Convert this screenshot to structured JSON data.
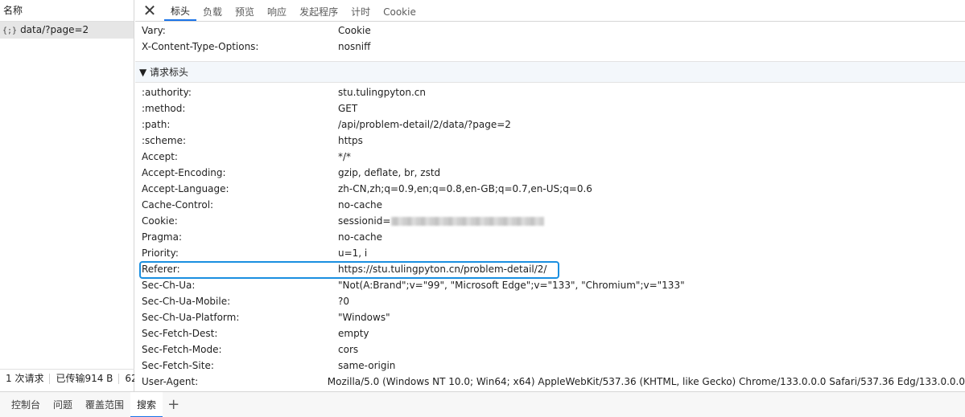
{
  "left": {
    "header": "名称",
    "request_icon": "{;}",
    "request_name": "data/?page=2",
    "status": {
      "requests": "1 次请求",
      "transferred": "已传输914 B",
      "extra": "62"
    }
  },
  "tabs": [
    "标头",
    "负载",
    "预览",
    "响应",
    "发起程序",
    "计时",
    "Cookie"
  ],
  "active_tab": 0,
  "close_icon": "close-icon",
  "response_headers": [
    {
      "key": "Vary:",
      "value": "Cookie"
    },
    {
      "key": "X-Content-Type-Options:",
      "value": "nosniff"
    }
  ],
  "request_section_title": "▼ 请求标头",
  "request_headers": [
    {
      "key": ":authority:",
      "value": "stu.tulingpyton.cn"
    },
    {
      "key": ":method:",
      "value": "GET"
    },
    {
      "key": ":path:",
      "value": "/api/problem-detail/2/data/?page=2"
    },
    {
      "key": ":scheme:",
      "value": "https"
    },
    {
      "key": "Accept:",
      "value": "*/*"
    },
    {
      "key": "Accept-Encoding:",
      "value": "gzip, deflate, br, zstd"
    },
    {
      "key": "Accept-Language:",
      "value": "zh-CN,zh;q=0.9,en;q=0.8,en-GB;q=0.7,en-US;q=0.6"
    },
    {
      "key": "Cache-Control:",
      "value": "no-cache"
    },
    {
      "key": "Cookie:",
      "value": "sessionid=",
      "redacted": true
    },
    {
      "key": "Pragma:",
      "value": "no-cache"
    },
    {
      "key": "Priority:",
      "value": "u=1, i"
    },
    {
      "key": "Referer:",
      "value": "https://stu.tulingpyton.cn/problem-detail/2/",
      "highlighted": true
    },
    {
      "key": "Sec-Ch-Ua:",
      "value": "\"Not(A:Brand\";v=\"99\", \"Microsoft Edge\";v=\"133\", \"Chromium\";v=\"133\""
    },
    {
      "key": "Sec-Ch-Ua-Mobile:",
      "value": "?0"
    },
    {
      "key": "Sec-Ch-Ua-Platform:",
      "value": "\"Windows\""
    },
    {
      "key": "Sec-Fetch-Dest:",
      "value": "empty"
    },
    {
      "key": "Sec-Fetch-Mode:",
      "value": "cors"
    },
    {
      "key": "Sec-Fetch-Site:",
      "value": "same-origin"
    },
    {
      "key": "User-Agent:",
      "value": "Mozilla/5.0 (Windows NT 10.0; Win64; x64) AppleWebKit/537.36 (KHTML, like Gecko) Chrome/133.0.0.0 Safari/537.36 Edg/133.0.0.0"
    }
  ],
  "bottom_tabs": [
    "控制台",
    "问题",
    "覆盖范围",
    "搜索"
  ],
  "bottom_active": 3,
  "add_tab_label": "+",
  "colors": {
    "accent": "#1a73e8",
    "highlight": "#1a8fe0"
  }
}
